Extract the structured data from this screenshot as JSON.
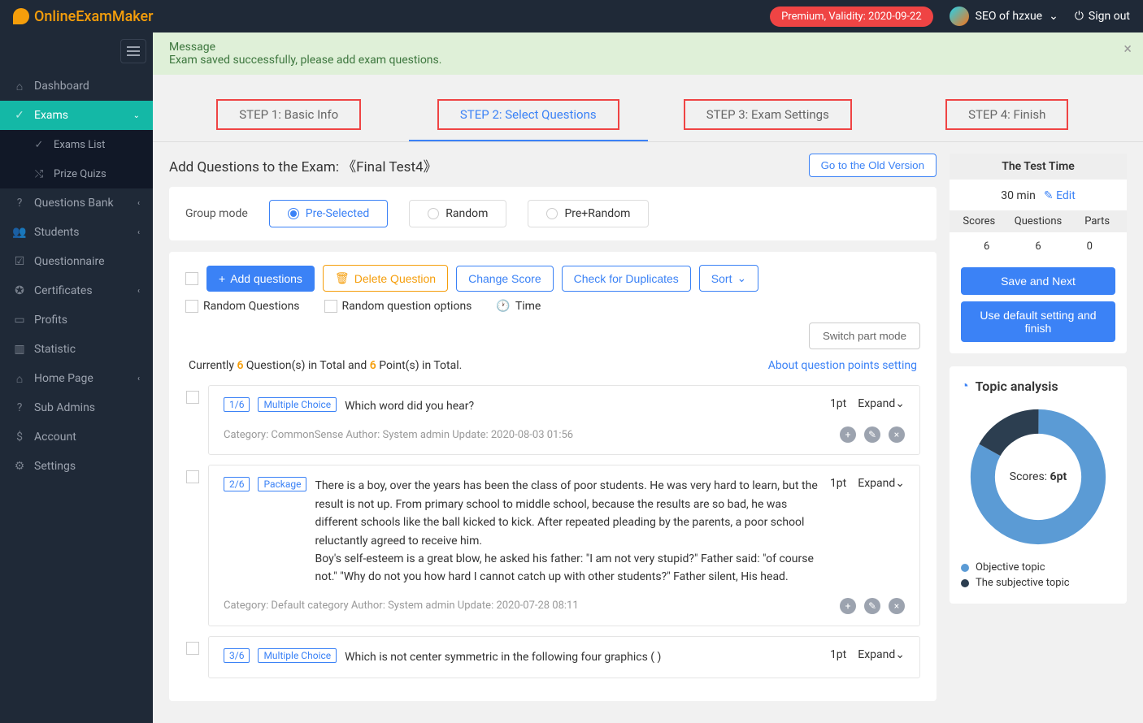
{
  "topbar": {
    "logo": "OnlineExamMaker",
    "premium": "Premium, Validity: 2020-09-22",
    "user": "SEO of hzxue",
    "signout": "Sign out"
  },
  "sidebar": {
    "items": [
      {
        "label": "Dashboard",
        "icon": "home"
      },
      {
        "label": "Exams",
        "icon": "check",
        "active": true,
        "expanded": true,
        "children": [
          {
            "label": "Exams List",
            "icon": "check"
          },
          {
            "label": "Prize Quizs",
            "icon": "shuffle"
          }
        ]
      },
      {
        "label": "Questions Bank",
        "icon": "help",
        "chev": true
      },
      {
        "label": "Students",
        "icon": "users",
        "chev": true
      },
      {
        "label": "Questionnaire",
        "icon": "form"
      },
      {
        "label": "Certificates",
        "icon": "badge",
        "chev": true
      },
      {
        "label": "Profits",
        "icon": "card"
      },
      {
        "label": "Statistic",
        "icon": "chart"
      },
      {
        "label": "Home Page",
        "icon": "home2",
        "chev": true
      },
      {
        "label": "Sub Admins",
        "icon": "help"
      },
      {
        "label": "Account",
        "icon": "dollar"
      },
      {
        "label": "Settings",
        "icon": "gear"
      }
    ]
  },
  "message": {
    "title": "Message",
    "body": "Exam saved successfully, please add exam questions."
  },
  "steps": [
    {
      "label": "STEP 1: Basic Info"
    },
    {
      "label": "STEP 2: Select Questions",
      "active": true
    },
    {
      "label": "STEP 3: Exam Settings"
    },
    {
      "label": "STEP 4: Finish"
    }
  ],
  "page": {
    "title_prefix": "Add Questions to the Exam: ",
    "exam_name": "《Final Test4》",
    "old_version": "Go to the Old Version"
  },
  "group_mode": {
    "label": "Group mode",
    "pre": "Pre-Selected",
    "random": "Random",
    "pre_random": "Pre+Random"
  },
  "toolbar": {
    "add": "Add questions",
    "delete": "Delete Question",
    "change": "Change Score",
    "dup": "Check for Duplicates",
    "sort": "Sort"
  },
  "options_row": {
    "random_q": "Random Questions",
    "random_opt": "Random question options",
    "time": "Time"
  },
  "switch_mode": "Switch part mode",
  "summary": {
    "p1": "Currently ",
    "n1": "6",
    "p2": " Question(s) in Total and ",
    "n2": "6",
    "p3": " Point(s) in Total.",
    "link": "About question points setting"
  },
  "questions": [
    {
      "idx": "1/6",
      "type": "Multiple Choice",
      "text": "Which word did you hear?",
      "pt": "1pt",
      "expand": "Expand",
      "meta": "Category: CommonSense   Author: System admin   Update: 2020-08-03 01:56"
    },
    {
      "idx": "2/6",
      "type": "Package",
      "text": "There is a boy, over the years has been the class of poor students. He was very hard to learn, but the result is not up. From primary school to middle school, because the results are so bad, he was different schools like the ball kicked to kick. After repeated pleading by the parents, a poor school reluctantly agreed to receive him.\n        Boy's self-esteem is a great blow, he asked his father: \"I am not very stupid?\" Father said: \"of course not.\" \"Why do not you how hard I cannot catch up with other students?\" Father silent, His head.",
      "pt": "1pt",
      "expand": "Expand",
      "meta": "Category: Default category   Author: System admin   Update: 2020-07-28 08:11"
    },
    {
      "idx": "3/6",
      "type": "Multiple Choice",
      "text": "Which is not center symmetric in the following four graphics (  )",
      "pt": "1pt",
      "expand": "Expand",
      "meta": ""
    }
  ],
  "right": {
    "test_time_title": "The Test Time",
    "time_val": "30 min",
    "edit": "Edit",
    "scores_h": "Scores",
    "questions_h": "Questions",
    "parts_h": "Parts",
    "scores_v": "6",
    "questions_v": "6",
    "parts_v": "0",
    "save_next": "Save and Next",
    "use_default": "Use default setting and finish",
    "analysis_title": "Topic analysis",
    "donut_label": "Scores: ",
    "donut_val": "6pt",
    "legend1": "Objective topic",
    "legend2": "The subjective topic"
  },
  "colors": {
    "primary": "#3b82f6",
    "teal": "#14b8a6",
    "donut_blue": "#5b9bd5",
    "donut_dark": "#2c3e50"
  },
  "chart_data": {
    "type": "pie",
    "title": "Topic analysis",
    "series": [
      {
        "name": "Objective topic",
        "value": 5,
        "color": "#5b9bd5"
      },
      {
        "name": "The subjective topic",
        "value": 1,
        "color": "#2c3e50"
      }
    ],
    "total_label": "Scores: 6pt"
  }
}
